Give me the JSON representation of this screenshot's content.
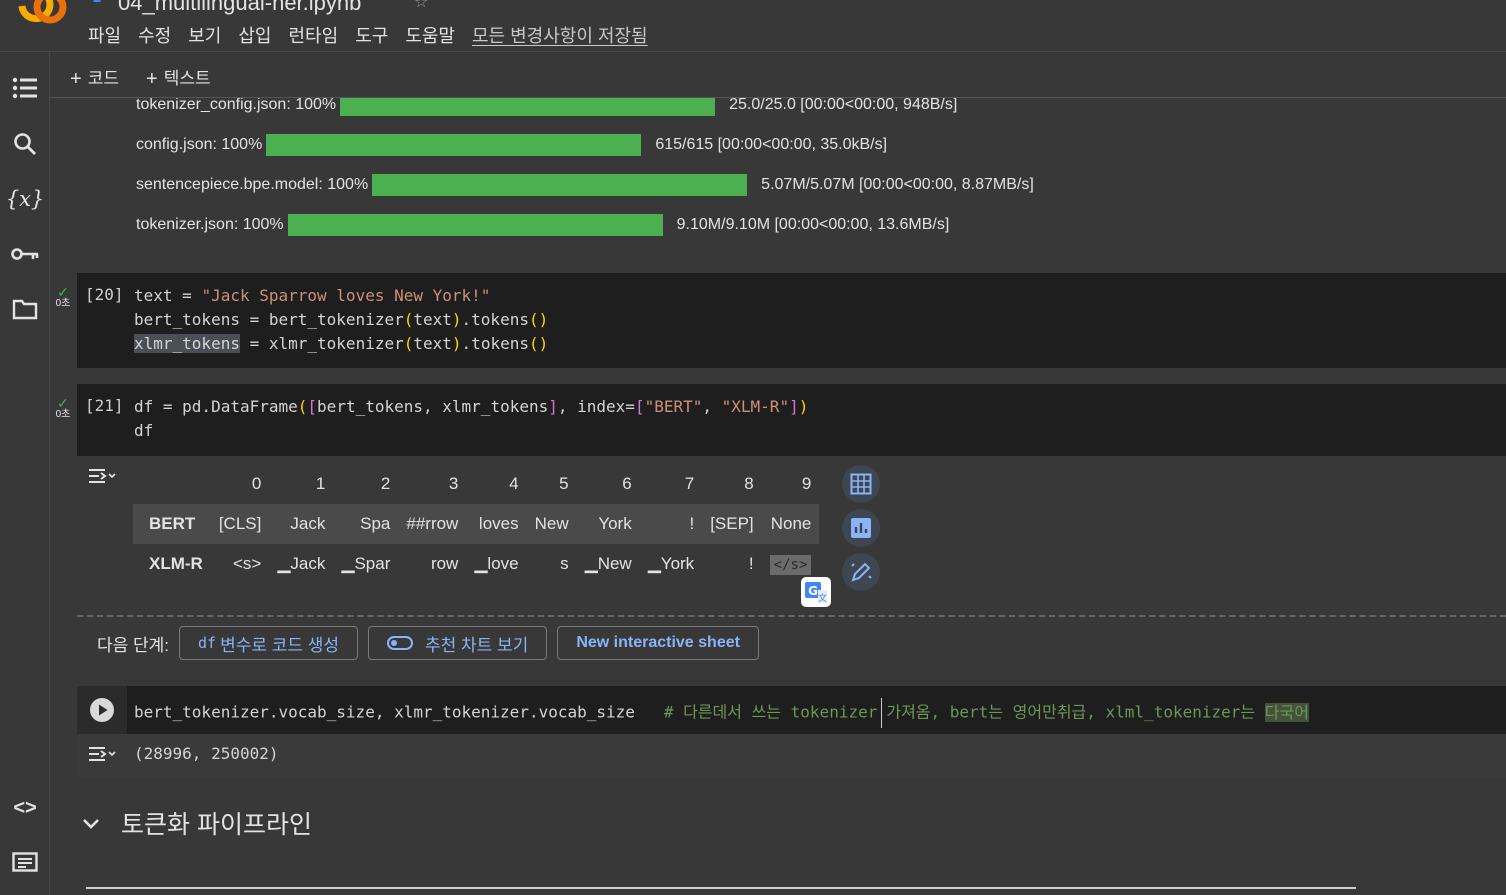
{
  "header": {
    "title": "04_multilingual-ner.ipynb",
    "menu": [
      "파일",
      "수정",
      "보기",
      "삽입",
      "런타임",
      "도구",
      "도움말"
    ],
    "saved_status": "모든 변경사항이 저장됨"
  },
  "toolbar": {
    "add_code": "코드",
    "add_text": "텍스트"
  },
  "sidebar": [
    "toc-icon",
    "search-icon",
    "variables-icon",
    "secrets-key-icon",
    "folder-icon",
    "code-snippets-icon",
    "terminal-icon"
  ],
  "progress": [
    {
      "label": "tokenizer_config.json:  100%",
      "fraction": 1.0,
      "stats": "25.0/25.0  [00:00<00:00,  948B/s]"
    },
    {
      "label": "config.json:  100%",
      "fraction": 1.0,
      "stats": "615/615  [00:00<00:00,  35.0kB/s]"
    },
    {
      "label": "sentencepiece.bpe.model:  100%",
      "fraction": 1.0,
      "stats": "5.07M/5.07M  [00:00<00:00,  8.87MB/s]"
    },
    {
      "label": "tokenizer.json:  100%",
      "fraction": 1.0,
      "stats": "9.10M/9.10M  [00:00<00:00,  13.6MB/s]"
    }
  ],
  "cell20": {
    "count": "[20]",
    "time": "0초",
    "line1_a": "text = ",
    "line1_str": "\"Jack Sparrow loves New York!\"",
    "line2_a": "bert_tokens = bert_tokenizer",
    "line2_p1": "(",
    "line2_b": "text",
    "line2_p2": ")",
    "line2_c": ".tokens",
    "line2_p3": "()",
    "line3_sel": "xlmr_tokens",
    "line3_a": " = xlmr_tokenizer",
    "line3_p1": "(",
    "line3_b": "text",
    "line3_p2": ")",
    "line3_c": ".tokens",
    "line3_p3": "()"
  },
  "cell21": {
    "count": "[21]",
    "time": "0초",
    "line1_a": "df = pd.DataFrame",
    "line1_p1": "(",
    "line1_p2": "[",
    "line1_b": "bert_tokens, xlmr_tokens",
    "line1_p3": "]",
    "line1_c": ", index=",
    "line1_p4": "[",
    "line1_s1": "\"BERT\"",
    "line1_d": ", ",
    "line1_s2": "\"XLM-R\"",
    "line1_p5": "]",
    "line1_p6": ")",
    "line2": "df"
  },
  "dataframe": {
    "columns": [
      "",
      "0",
      "1",
      "2",
      "3",
      "4",
      "5",
      "6",
      "7",
      "8",
      "9"
    ],
    "rows": [
      [
        "BERT",
        "[CLS]",
        "Jack",
        "Spa",
        "##rrow",
        "loves",
        "New",
        "York",
        "!",
        "[SEP]",
        "None"
      ],
      [
        "XLM-R",
        "<s>",
        "▁Jack",
        "▁Spar",
        "row",
        "▁love",
        "s",
        "▁New",
        "▁York",
        "!",
        "</s>"
      ]
    ]
  },
  "next_steps": {
    "label": "다음 단계:",
    "btn1_prefix": "df",
    "btn1": "변수로 코드 생성",
    "btn2": "추천 차트 보기",
    "btn3": "New interactive sheet"
  },
  "cell22": {
    "code": "bert_tokenizer.vocab_size, xlmr_tokenizer.vocab_size",
    "comment_a": "# 다른데서 쓰는 tokenizer",
    "comment_b": "가져옴, bert는 영어만취급, xlml_tokenizer는 ",
    "comment_hl": "다국어",
    "output": "(28996, 250002)"
  },
  "section": {
    "title": "토큰화 파이프라인"
  },
  "colors": {
    "progress_fill": "#4caf50",
    "link_blue": "#8ab4f8",
    "string": "#ce9178",
    "comment": "#6a9955"
  }
}
